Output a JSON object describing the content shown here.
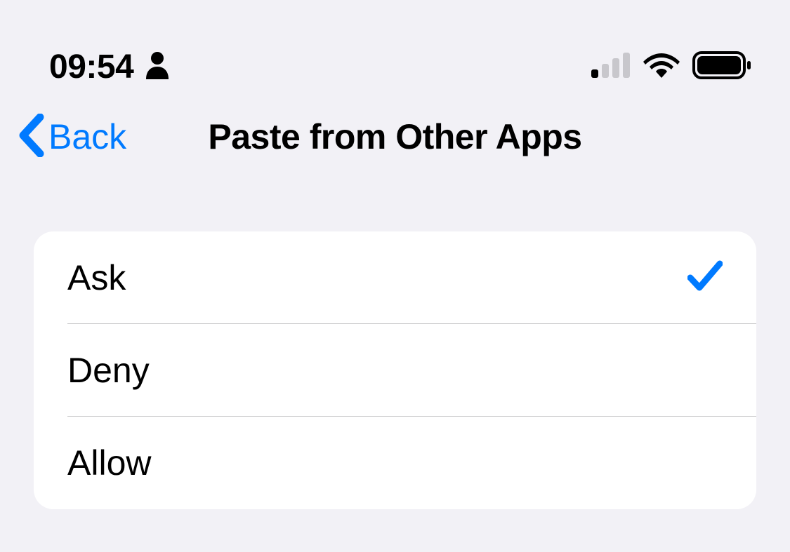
{
  "status_bar": {
    "time": "09:54"
  },
  "nav": {
    "back_label": "Back",
    "title": "Paste from Other Apps"
  },
  "options": [
    {
      "label": "Ask",
      "selected": true
    },
    {
      "label": "Deny",
      "selected": false
    },
    {
      "label": "Allow",
      "selected": false
    }
  ]
}
